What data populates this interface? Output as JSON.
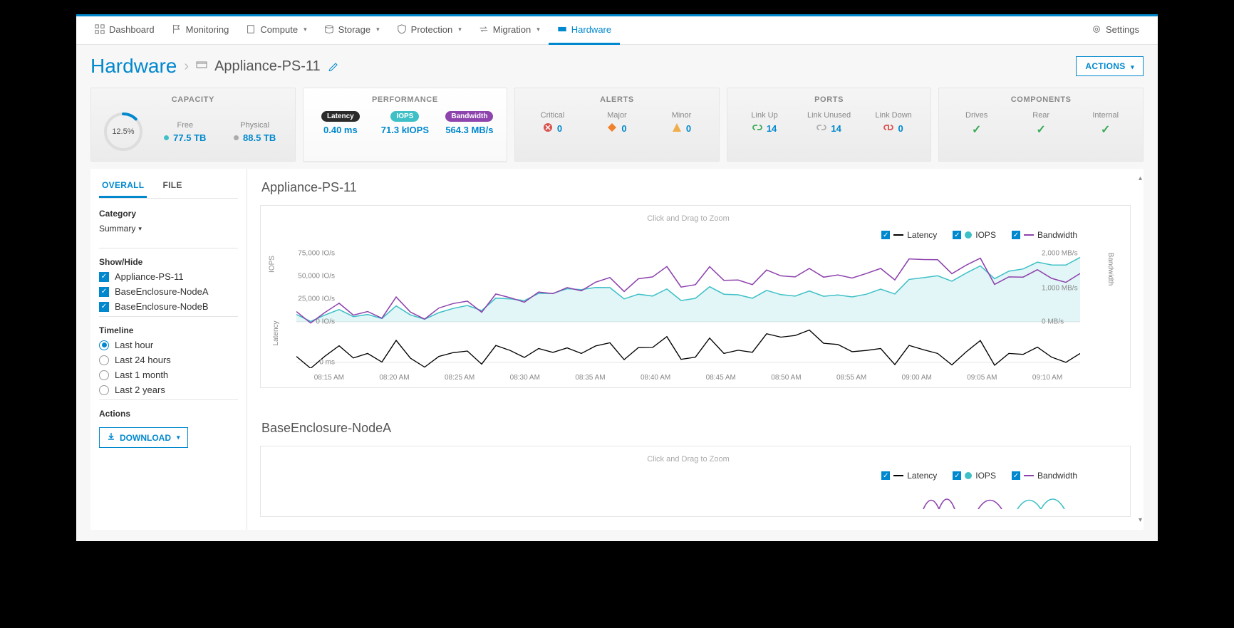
{
  "nav": {
    "items": [
      {
        "label": "Dashboard",
        "icon": "dashboard",
        "caret": false
      },
      {
        "label": "Monitoring",
        "icon": "flag",
        "caret": false
      },
      {
        "label": "Compute",
        "icon": "compute",
        "caret": true
      },
      {
        "label": "Storage",
        "icon": "storage",
        "caret": true
      },
      {
        "label": "Protection",
        "icon": "shield",
        "caret": true
      },
      {
        "label": "Migration",
        "icon": "migration",
        "caret": true
      },
      {
        "label": "Hardware",
        "icon": "hardware",
        "caret": false,
        "active": true
      }
    ],
    "settings": "Settings"
  },
  "breadcrumb": {
    "root": "Hardware",
    "current": "Appliance-PS-11"
  },
  "actions_label": "ACTIONS",
  "tiles": {
    "capacity": {
      "title": "CAPACITY",
      "percent_label": "12.5%",
      "percent_value": 12.5,
      "cols": [
        {
          "label": "Free",
          "value": "77.5 TB",
          "dot": "#3fc0c7"
        },
        {
          "label": "Physical",
          "value": "88.5 TB",
          "dot": "#aaaaaa"
        }
      ]
    },
    "performance": {
      "title": "PERFORMANCE",
      "active": true,
      "cols": [
        {
          "badge": "Latency",
          "badge_bg": "#2b2b2b",
          "value": "0.40 ms"
        },
        {
          "badge": "IOPS",
          "badge_bg": "#3fc0c7",
          "value": "71.3 kIOPS"
        },
        {
          "badge": "Bandwidth",
          "badge_bg": "#8e44ad",
          "value": "564.3 MB/s"
        }
      ]
    },
    "alerts": {
      "title": "ALERTS",
      "cols": [
        {
          "label": "Critical",
          "icon": "critical",
          "value": "0"
        },
        {
          "label": "Major",
          "icon": "major",
          "value": "0"
        },
        {
          "label": "Minor",
          "icon": "minor",
          "value": "0"
        }
      ]
    },
    "ports": {
      "title": "PORTS",
      "cols": [
        {
          "label": "Link Up",
          "icon": "link-up",
          "value": "14"
        },
        {
          "label": "Link Unused",
          "icon": "link-unused",
          "value": "14"
        },
        {
          "label": "Link Down",
          "icon": "link-down",
          "value": "0"
        }
      ]
    },
    "components": {
      "title": "COMPONENTS",
      "cols": [
        {
          "label": "Drives"
        },
        {
          "label": "Rear"
        },
        {
          "label": "Internal"
        }
      ]
    }
  },
  "left_panel": {
    "tabs": [
      {
        "label": "OVERALL",
        "active": true
      },
      {
        "label": "FILE",
        "active": false
      }
    ],
    "category_title": "Category",
    "category_value": "Summary",
    "showhide_title": "Show/Hide",
    "showhide_items": [
      {
        "label": "Appliance-PS-11",
        "checked": true
      },
      {
        "label": "BaseEnclosure-NodeA",
        "checked": true
      },
      {
        "label": "BaseEnclosure-NodeB",
        "checked": true
      }
    ],
    "timeline_title": "Timeline",
    "timeline_items": [
      {
        "label": "Last hour",
        "selected": true
      },
      {
        "label": "Last 24 hours",
        "selected": false
      },
      {
        "label": "Last 1 month",
        "selected": false
      },
      {
        "label": "Last 2 years",
        "selected": false
      }
    ],
    "actions_title": "Actions",
    "download_label": "DOWNLOAD"
  },
  "charts": {
    "hint": "Click and Drag to Zoom",
    "legend": [
      {
        "label": "Latency",
        "style": "line",
        "color": "#000000"
      },
      {
        "label": "IOPS",
        "style": "dot",
        "color": "#3fc0c7"
      },
      {
        "label": "Bandwidth",
        "style": "line",
        "color": "#8e44ad"
      }
    ],
    "blocks": [
      {
        "title": "Appliance-PS-11"
      },
      {
        "title": "BaseEnclosure-NodeA"
      }
    ],
    "y_left_label_upper": "IOPS",
    "y_left_label_lower": "Latency",
    "y_right_label": "Bandwidth",
    "y_left_ticks": [
      "75,000 IO/s",
      "50,000 IO/s",
      "25,000 IO/s",
      "0 IO/s"
    ],
    "y_left_lower_ticks": [
      "0 ms"
    ],
    "y_right_ticks": [
      "2,000 MB/s",
      "1,000 MB/s",
      "0 MB/s"
    ],
    "x_ticks": [
      "08:15 AM",
      "08:20 AM",
      "08:25 AM",
      "08:30 AM",
      "08:35 AM",
      "08:40 AM",
      "08:45 AM",
      "08:50 AM",
      "08:55 AM",
      "09:00 AM",
      "09:05 AM",
      "09:10 AM"
    ]
  },
  "chart_data": {
    "type": "line",
    "title": "Appliance-PS-11",
    "x": [
      "08:15 AM",
      "08:20 AM",
      "08:25 AM",
      "08:30 AM",
      "08:35 AM",
      "08:40 AM",
      "08:45 AM",
      "08:50 AM",
      "08:55 AM",
      "09:00 AM",
      "09:05 AM",
      "09:10 AM"
    ],
    "series": [
      {
        "name": "IOPS",
        "unit": "IO/s",
        "axis": "left-upper",
        "values": [
          8000,
          8000,
          10000,
          25000,
          35000,
          28000,
          30000,
          28000,
          30000,
          50000,
          55000,
          70000
        ]
      },
      {
        "name": "Bandwidth",
        "unit": "MB/s",
        "axis": "right",
        "values": [
          300,
          300,
          400,
          700,
          900,
          1300,
          1200,
          1300,
          1400,
          1800,
          1300,
          1400
        ]
      },
      {
        "name": "Latency",
        "unit": "ms",
        "axis": "left-lower",
        "values": [
          0.2,
          0.3,
          0.2,
          0.4,
          0.3,
          0.5,
          0.3,
          0.9,
          0.4,
          0.3,
          0.3,
          0.3
        ]
      }
    ],
    "y_left_upper": {
      "label": "IOPS",
      "range": [
        0,
        75000
      ]
    },
    "y_left_lower": {
      "label": "Latency",
      "range": [
        0,
        1.0
      ]
    },
    "y_right": {
      "label": "Bandwidth",
      "range": [
        0,
        2000
      ]
    }
  }
}
